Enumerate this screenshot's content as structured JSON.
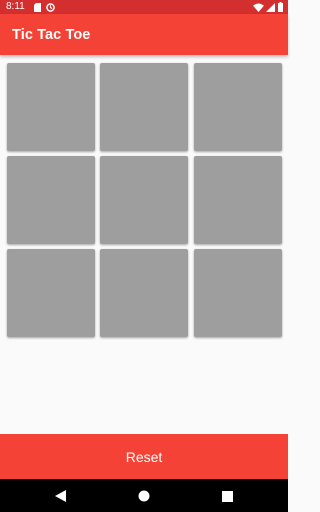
{
  "status_bar": {
    "time": "8:11",
    "icons_left": [
      "sd-card-icon",
      "sync-icon"
    ],
    "icons_right": [
      "wifi-icon",
      "signal-icon",
      "battery-icon"
    ]
  },
  "app_bar": {
    "title": "Tic Tac Toe",
    "color": "#f44336"
  },
  "board": {
    "cells": [
      "",
      "",
      "",
      "",
      "",
      "",
      "",
      "",
      ""
    ],
    "cell_color": "#9e9e9e"
  },
  "footer": {
    "reset_label": "Reset"
  },
  "nav_bar": {
    "buttons": [
      "back-icon",
      "home-icon",
      "recents-icon"
    ]
  }
}
